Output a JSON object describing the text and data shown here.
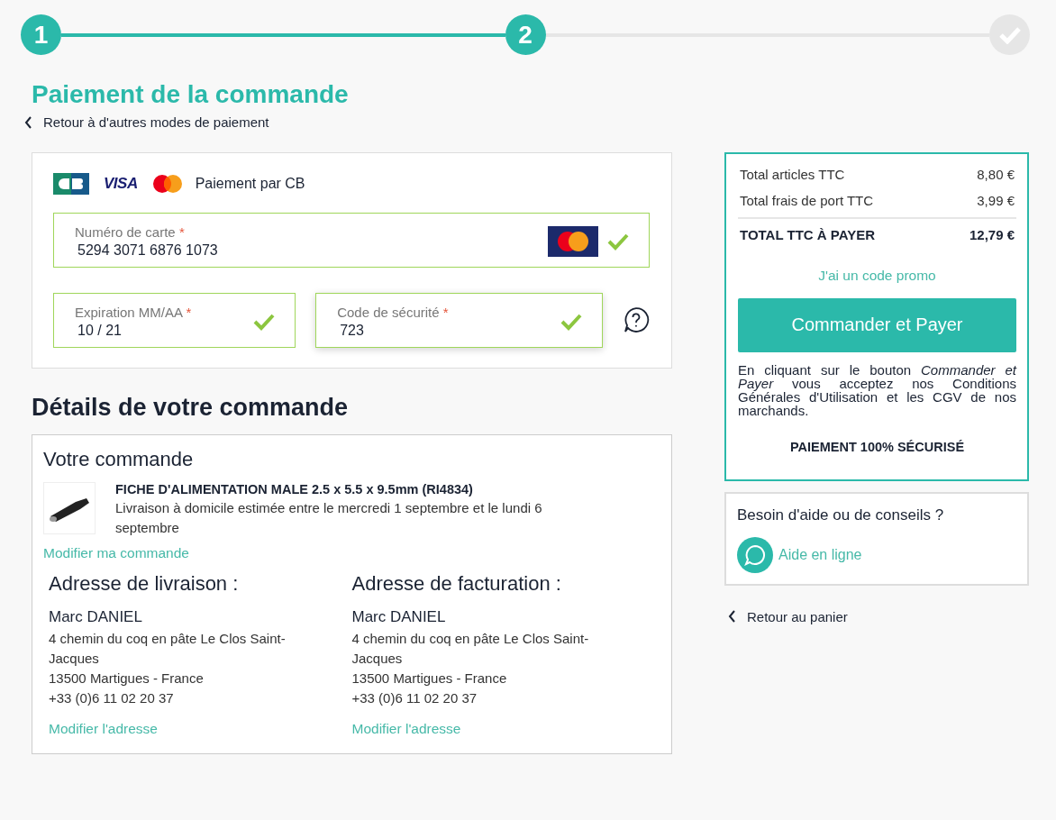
{
  "steps": [
    {
      "kind": "number",
      "label": "1",
      "reached": true
    },
    {
      "kind": "number",
      "label": "2",
      "reached": true
    },
    {
      "kind": "check",
      "reached": false
    }
  ],
  "page_title": "Paiement de la commande",
  "back_link": "Retour à d'autres modes de paiement",
  "payment": {
    "brands": [
      {
        "kind": "cb"
      },
      {
        "kind": "visa",
        "text": "VISA"
      },
      {
        "kind": "mastercard"
      }
    ],
    "method": "Paiement par CB",
    "fields": [
      {
        "kind": "card",
        "label": "Numéro de carte",
        "required_mark": "*",
        "value": "5294 3071 6876 1073",
        "valid": true,
        "focused": false
      },
      {
        "kind": "expiry",
        "label": "Expiration MM/AA",
        "required_mark": "*",
        "value": "10 / 21",
        "valid": true,
        "focused": false
      },
      {
        "kind": "cvv",
        "label": "Code de sécurité",
        "required_mark": "*",
        "value": "723",
        "valid": true,
        "focused": true
      }
    ]
  },
  "order": {
    "heading": "Détails de votre commande",
    "title": "Votre commande",
    "item": {
      "name": "FICHE D'ALIMENTATION MALE 2.5 x 5.5 x 9.5mm (RI4834)",
      "delivery": "Livraison à domicile estimée entre le mercredi 1 septembre et le lundi 6 septembre"
    },
    "edit_link": "Modifier ma commande",
    "addresses": [
      {
        "title": "Adresse de livraison :",
        "name": "Marc DANIEL",
        "lines": [
          "4 chemin du coq en pâte Le Clos Saint-Jacques",
          "13500 Martigues - France",
          "+33 (0)6 11 02 20 37"
        ],
        "edit_link": "Modifier l'adresse"
      },
      {
        "title": "Adresse de facturation :",
        "name": "Marc DANIEL",
        "lines": [
          "4 chemin du coq en pâte Le Clos Saint-Jacques",
          "13500 Martigues - France",
          "+33 (0)6 11 02 20 37"
        ],
        "edit_link": "Modifier l'adresse"
      }
    ]
  },
  "summary": {
    "rows": [
      {
        "kind": "line",
        "label": "Total articles TTC",
        "value": "8,80 €"
      },
      {
        "kind": "line",
        "label": "Total frais de port TTC",
        "value": "3,99 €"
      },
      {
        "kind": "total",
        "label": "TOTAL TTC À PAYER",
        "value": "12,79 €"
      }
    ],
    "promo_link": "J'ai un code promo",
    "button": "Commander et Payer",
    "legal": "En cliquant sur le bouton *Commander et Payer* vous acceptez nos Conditions Générales d'Utilisation et les CGV de nos marchands.",
    "secure": "PAIEMENT 100% SÉCURISÉ"
  },
  "help": {
    "title": "Besoin d'aide ou de conseils ?",
    "link": "Aide en ligne"
  },
  "back_to_cart": "Retour au panier"
}
